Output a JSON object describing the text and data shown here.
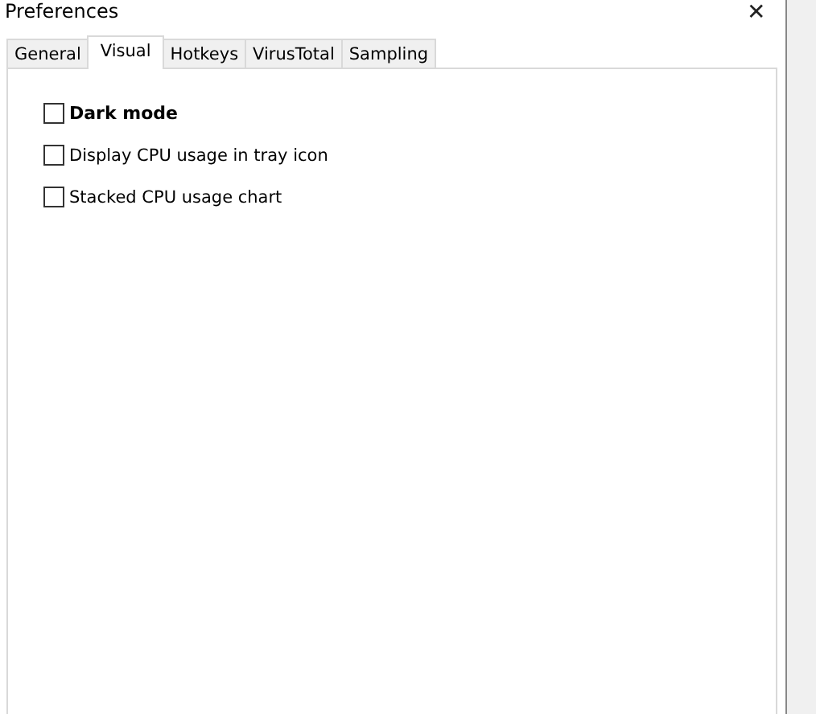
{
  "window": {
    "title": "Preferences",
    "close": "✕"
  },
  "tabs": [
    {
      "label": "General",
      "selected": false
    },
    {
      "label": "Visual",
      "selected": true
    },
    {
      "label": "Hotkeys",
      "selected": false
    },
    {
      "label": "VirusTotal",
      "selected": false
    },
    {
      "label": "Sampling",
      "selected": false
    }
  ],
  "options": [
    {
      "label": "Dark mode",
      "checked": false,
      "bold": true
    },
    {
      "label": "Display CPU usage in tray icon",
      "checked": false,
      "bold": false
    },
    {
      "label": "Stacked CPU usage chart",
      "checked": false,
      "bold": false
    }
  ]
}
